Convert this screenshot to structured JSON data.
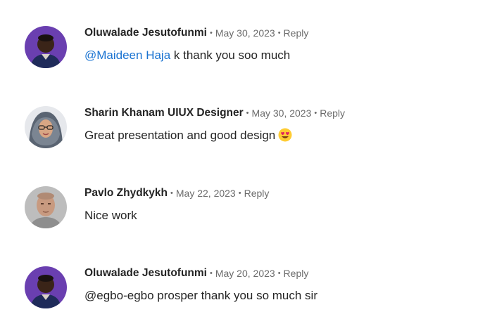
{
  "comments": [
    {
      "author": "Oluwalade Jesutofunmi",
      "date": "May 30, 2023",
      "reply_label": "Reply",
      "mention": "@Maideen Haja",
      "text": " k thank you soo much",
      "avatar_icon": "user-photo-dark-male-purple-bg"
    },
    {
      "author": "Sharin Khanam UIUX Designer",
      "date": "May 30, 2023",
      "reply_label": "Reply",
      "text": "Great presentation and good design",
      "emoji_icon": "smiling-face-with-heart-eyes-icon",
      "avatar_icon": "user-photo-hijab-glasses"
    },
    {
      "author": "Pavlo Zhydkykh",
      "date": "May 22, 2023",
      "reply_label": "Reply",
      "text": "Nice work",
      "avatar_icon": "user-photo-bald-male-grey-bg"
    },
    {
      "author": "Oluwalade Jesutofunmi",
      "date": "May 20, 2023",
      "reply_label": "Reply",
      "text": "@egbo-egbo prosper thank you so much sir",
      "avatar_icon": "user-photo-dark-male-purple-bg"
    }
  ],
  "colors": {
    "author": "#242424",
    "meta": "#6b6b6b",
    "mention": "#1a73d1",
    "body": "#242424"
  }
}
